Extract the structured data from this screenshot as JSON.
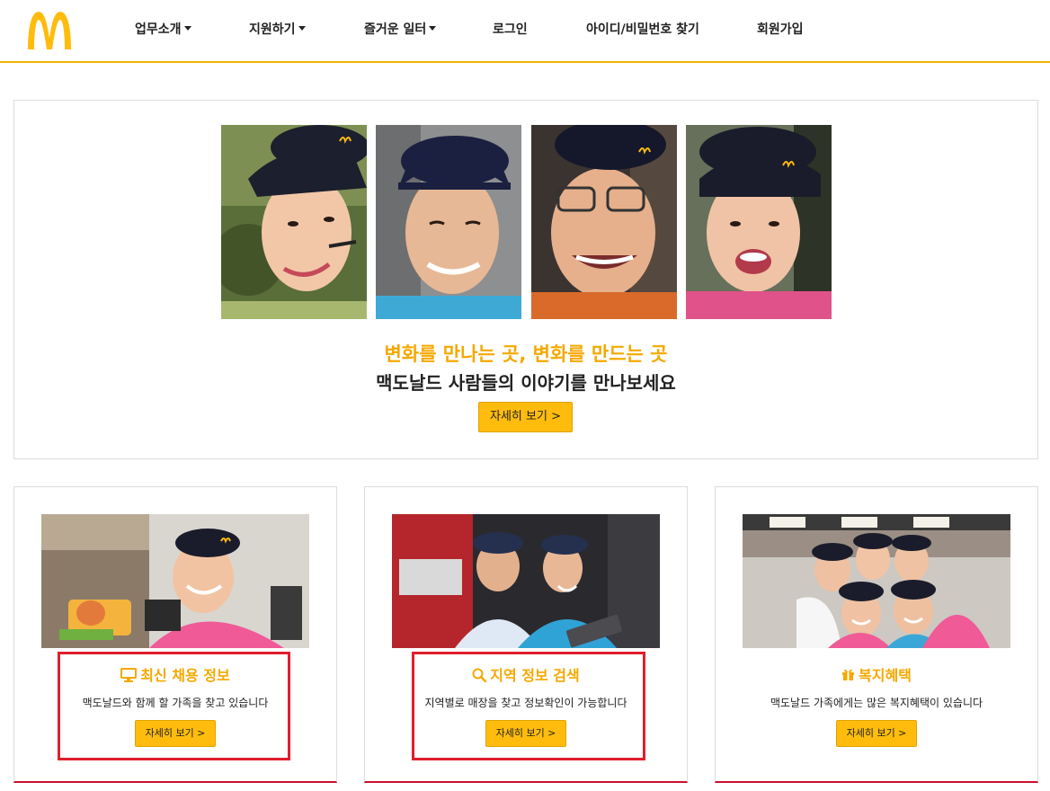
{
  "nav": {
    "logo_icon": "mcdonalds-golden-arches-icon",
    "items": [
      {
        "label": "업무소개",
        "dropdown": true
      },
      {
        "label": "지원하기",
        "dropdown": true
      },
      {
        "label": "즐거운 일터",
        "dropdown": true
      },
      {
        "label": "로그인",
        "dropdown": false
      },
      {
        "label": "아이디/비밀번호 찾기",
        "dropdown": false
      },
      {
        "label": "회원가입",
        "dropdown": false
      }
    ]
  },
  "hero": {
    "title": "변화를 만나는 곳, 변화를 만드는 곳",
    "subtitle": "맥도날드 사람들의 이야기를 만나보세요",
    "button_label": "자세히 보기 >"
  },
  "cards": [
    {
      "icon": "monitor-icon",
      "title": "최신 채용 정보",
      "description": "맥도날드와 함께 할 가족을 찾고 있습니다",
      "button_label": "자세히 보기 >"
    },
    {
      "icon": "search-icon",
      "title": "지역 정보 검색",
      "description": "지역별로 매장을 찾고 정보확인이 가능합니다",
      "button_label": "자세히 보기 >"
    },
    {
      "icon": "gift-icon",
      "title": "복지혜택",
      "description": "맥도날드 가족에게는 많은 복지혜택이 있습니다",
      "button_label": "자세히 보기 >"
    }
  ],
  "colors": {
    "brand_yellow": "#ffbc0d",
    "title_gold": "#f5a800",
    "accent_red": "#c8102e",
    "highlight_red": "#e01f2d"
  }
}
